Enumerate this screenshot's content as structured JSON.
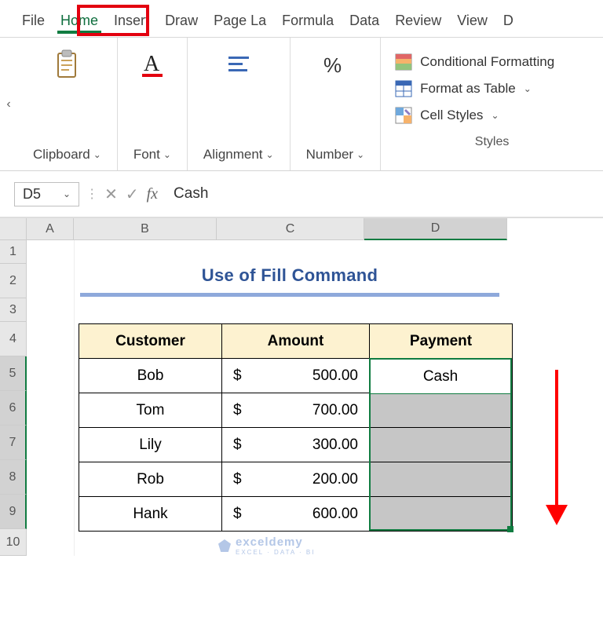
{
  "tabs": {
    "file": "File",
    "home": "Home",
    "insert": "Insert",
    "draw": "Draw",
    "pagelayout": "Page La",
    "formulas": "Formula",
    "data": "Data",
    "review": "Review",
    "view": "View",
    "extra": "D"
  },
  "ribbon": {
    "clipboard": "Clipboard",
    "font": "Font",
    "alignment": "Alignment",
    "number": "Number",
    "styles_caption": "Styles",
    "conditional_formatting": "Conditional Formatting",
    "format_as_table": "Format as Table",
    "cell_styles": "Cell Styles"
  },
  "formula_bar": {
    "cell_ref": "D5",
    "value": "Cash",
    "fx": "fx"
  },
  "columns": {
    "A": "A",
    "B": "B",
    "C": "C",
    "D": "D"
  },
  "row_numbers": [
    "1",
    "2",
    "3",
    "4",
    "5",
    "6",
    "7",
    "8",
    "9",
    "10"
  ],
  "title": "Use of Fill Command",
  "table": {
    "headers": {
      "customer": "Customer",
      "amount": "Amount",
      "payment": "Payment"
    },
    "currency": "$",
    "rows": [
      {
        "customer": "Bob",
        "amount": "500.00",
        "payment": "Cash"
      },
      {
        "customer": "Tom",
        "amount": "700.00",
        "payment": ""
      },
      {
        "customer": "Lily",
        "amount": "300.00",
        "payment": ""
      },
      {
        "customer": "Rob",
        "amount": "200.00",
        "payment": ""
      },
      {
        "customer": "Hank",
        "amount": "600.00",
        "payment": ""
      }
    ]
  },
  "watermark": {
    "brand": "exceldemy",
    "tag": "EXCEL · DATA · BI"
  },
  "colors": {
    "excel_green": "#107c41",
    "highlight_red": "#e3000f",
    "title_blue": "#2f5496"
  }
}
